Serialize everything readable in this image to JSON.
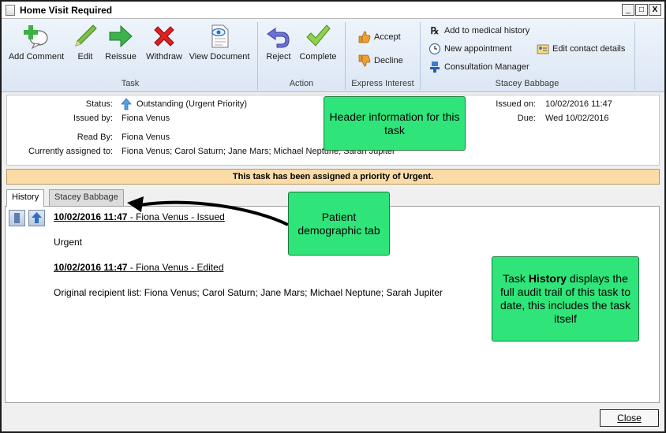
{
  "window": {
    "title": "Home Visit Required",
    "minimize": "_",
    "maximize": "□",
    "close": "X"
  },
  "ribbon": {
    "task_group": {
      "label": "Task",
      "buttons": [
        "Add Comment",
        "Edit",
        "Reissue",
        "Withdraw",
        "View Document"
      ]
    },
    "action_group": {
      "label": "Action",
      "buttons": [
        "Reject",
        "Complete"
      ]
    },
    "express_group": {
      "label": "Express Interest",
      "buttons": [
        "Accept",
        "Decline"
      ]
    },
    "patient_group": {
      "label": "Stacey Babbage",
      "buttons": [
        "Add to medical history",
        "New appointment",
        "Consultation Manager",
        "Edit contact details"
      ]
    }
  },
  "header": {
    "status_label": "Status:",
    "status_value": "Outstanding (Urgent Priority)",
    "issued_by_label": "Issued by:",
    "issued_by_value": "Fiona Venus",
    "read_by_label": "Read By:",
    "read_by_value": "Fiona Venus",
    "assigned_label": "Currently assigned to:",
    "assigned_value": "Fiona Venus; Carol Saturn; Jane Mars; Michael Neptune; Sarah Jupiter",
    "issued_on_label": "Issued on:",
    "issued_on_value": "10/02/2016 11:47",
    "due_label": "Due:",
    "due_value": "Wed 10/02/2016"
  },
  "banner": "This task has been assigned a priority of Urgent.",
  "tabs": [
    "History",
    "Stacey Babbage"
  ],
  "history": [
    {
      "timestamp": "10/02/2016 11:47",
      "suffix": " - Fiona Venus - Issued",
      "body": "Urgent"
    },
    {
      "timestamp": "10/02/2016 11:47",
      "suffix": " - Fiona Venus - Edited",
      "body": "Original recipient list: Fiona Venus; Carol Saturn; Jane Mars; Michael Neptune; Sarah Jupiter"
    }
  ],
  "callouts": {
    "header_info": "Header information for this task",
    "patient_tab": "Patient demographic tab",
    "history_pre": "Task ",
    "history_bold": "History",
    "history_post": " displays the full audit trail of this task to date, this includes the task itself"
  },
  "footer": {
    "close_label": "Close"
  },
  "colors": {
    "callout": "#2fe57a",
    "banner": "#fbdca7",
    "ribbon": "#dce7f4"
  }
}
